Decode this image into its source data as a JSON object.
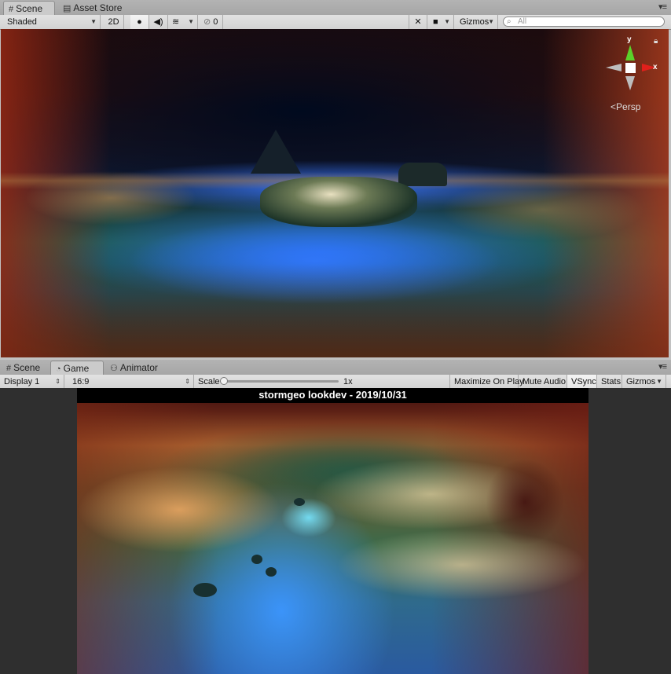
{
  "scene_window": {
    "tabs": [
      {
        "label": "Scene",
        "icon": "grid-icon",
        "active": true
      },
      {
        "label": "Asset Store",
        "icon": "store-icon",
        "active": false
      }
    ],
    "toolbar": {
      "shading_mode": "Shaded",
      "mode_2d": "2D",
      "hidden_count": "0",
      "gizmos_label": "Gizmos",
      "search_placeholder": "All"
    },
    "gizmo": {
      "y_label": "y",
      "x_label": "x",
      "projection": "Persp"
    }
  },
  "game_window": {
    "tabs": [
      {
        "label": "Scene",
        "icon": "grid-icon",
        "active": false
      },
      {
        "label": "Game",
        "icon": "pacman-icon",
        "active": true
      },
      {
        "label": "Animator",
        "icon": "animator-icon",
        "active": false
      }
    ],
    "toolbar": {
      "display": "Display 1",
      "aspect": "16:9",
      "scale_label": "Scale",
      "scale_value": "1x",
      "scale_fraction": 0.0,
      "maximize_on_play": "Maximize On Play",
      "mute_audio": "Mute Audio",
      "vsync": "VSync",
      "stats": "Stats",
      "gizmos": "Gizmos"
    },
    "overlay_title": "stormgeo lookdev - 2019/10/31"
  },
  "colors": {
    "gizmo_y": "#5bd12a",
    "gizmo_x": "#e0201b",
    "gizmo_neutral": "#bdbdbd"
  }
}
